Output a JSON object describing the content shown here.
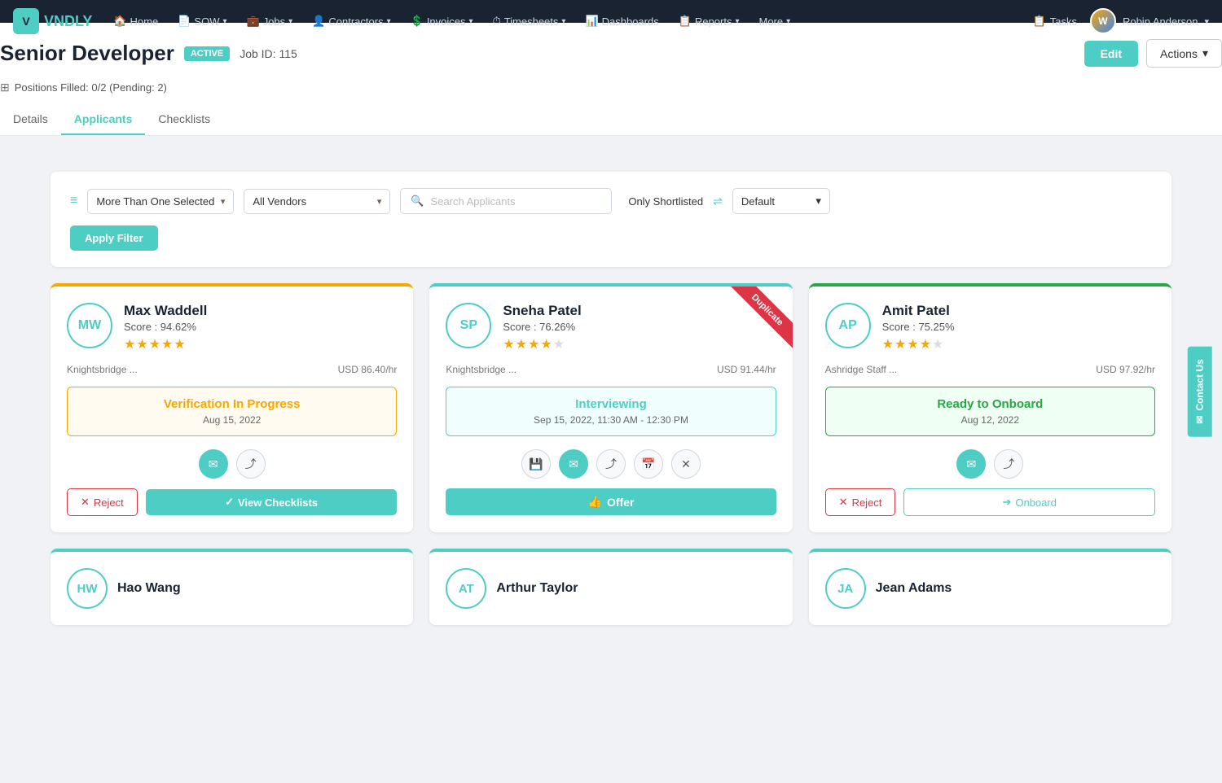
{
  "app": {
    "logo": "V",
    "logo_text": "VNDLY"
  },
  "navbar": {
    "items": [
      {
        "id": "home",
        "label": "Home",
        "icon": "🏠",
        "has_dropdown": false
      },
      {
        "id": "sow",
        "label": "SOW",
        "icon": "📄",
        "has_dropdown": true
      },
      {
        "id": "jobs",
        "label": "Jobs",
        "icon": "💼",
        "has_dropdown": true
      },
      {
        "id": "contractors",
        "label": "Contractors",
        "icon": "👤",
        "has_dropdown": true
      },
      {
        "id": "invoices",
        "label": "Invoices",
        "icon": "💲",
        "has_dropdown": true
      },
      {
        "id": "timesheets",
        "label": "Timesheets",
        "icon": "⏱",
        "has_dropdown": true
      },
      {
        "id": "dashboards",
        "label": "Dashboards",
        "icon": "📊",
        "has_dropdown": false
      },
      {
        "id": "reports",
        "label": "Reports",
        "icon": "📋",
        "has_dropdown": true
      },
      {
        "id": "more",
        "label": "More",
        "has_dropdown": true
      }
    ],
    "tasks_label": "Tasks",
    "user_name": "Robin Anderson",
    "user_initials": "W"
  },
  "page": {
    "title": "Senior Developer",
    "badge": "ACTIVE",
    "job_id": "Job ID: 115",
    "positions": "Positions Filled: 0/2 (Pending: 2)",
    "edit_label": "Edit",
    "actions_label": "Actions"
  },
  "tabs": [
    {
      "id": "details",
      "label": "Details",
      "active": false
    },
    {
      "id": "applicants",
      "label": "Applicants",
      "active": true
    },
    {
      "id": "checklists",
      "label": "Checklists",
      "active": false
    }
  ],
  "filters": {
    "selection_label": "More Than One Selected",
    "vendor_label": "All Vendors",
    "search_placeholder": "Search Applicants",
    "shortlist_label": "Only Shortlisted",
    "sort_label": "Default",
    "apply_label": "Apply Filter"
  },
  "candidates": [
    {
      "id": "mw",
      "initials": "MW",
      "name": "Max Waddell",
      "score": "Score : 94.62%",
      "stars": 5,
      "vendor": "Knightsbridge ...",
      "rate": "USD 86.40/hr",
      "status": "Verification In Progress",
      "status_type": "orange",
      "date": "Aug 15, 2022",
      "duplicate": false,
      "actions": {
        "has_save": false,
        "has_email": true,
        "has_share": true,
        "has_calendar": false,
        "has_close": false,
        "reject_label": "Reject",
        "primary_label": "View Checklists",
        "primary_type": "checklists"
      }
    },
    {
      "id": "sp",
      "initials": "SP",
      "name": "Sneha Patel",
      "score": "Score : 76.26%",
      "stars": 4,
      "vendor": "Knightsbridge ...",
      "rate": "USD 91.44/hr",
      "status": "Interviewing",
      "status_type": "green",
      "date": "Sep 15, 2022, 11:30 AM - 12:30 PM",
      "duplicate": true,
      "actions": {
        "has_save": true,
        "has_email": true,
        "has_share": true,
        "has_calendar": true,
        "has_close": true,
        "reject_label": "",
        "primary_label": "Offer",
        "primary_type": "offer"
      }
    },
    {
      "id": "ap",
      "initials": "AP",
      "name": "Amit Patel",
      "score": "Score : 75.25%",
      "stars": 4,
      "vendor": "Ashridge Staff ...",
      "rate": "USD 97.92/hr",
      "status": "Ready to Onboard",
      "status_type": "green2",
      "date": "Aug 12, 2022",
      "duplicate": false,
      "actions": {
        "has_save": false,
        "has_email": true,
        "has_share": true,
        "has_calendar": false,
        "has_close": false,
        "reject_label": "Reject",
        "primary_label": "Onboard",
        "primary_type": "onboard"
      }
    }
  ],
  "bottom_candidates": [
    {
      "id": "hw",
      "initials": "HW",
      "name": "Hao Wang"
    },
    {
      "id": "at",
      "initials": "AT",
      "name": "Arthur Taylor"
    },
    {
      "id": "ja",
      "initials": "JA",
      "name": "Jean Adams"
    }
  ],
  "contact_us": "Contact Us"
}
